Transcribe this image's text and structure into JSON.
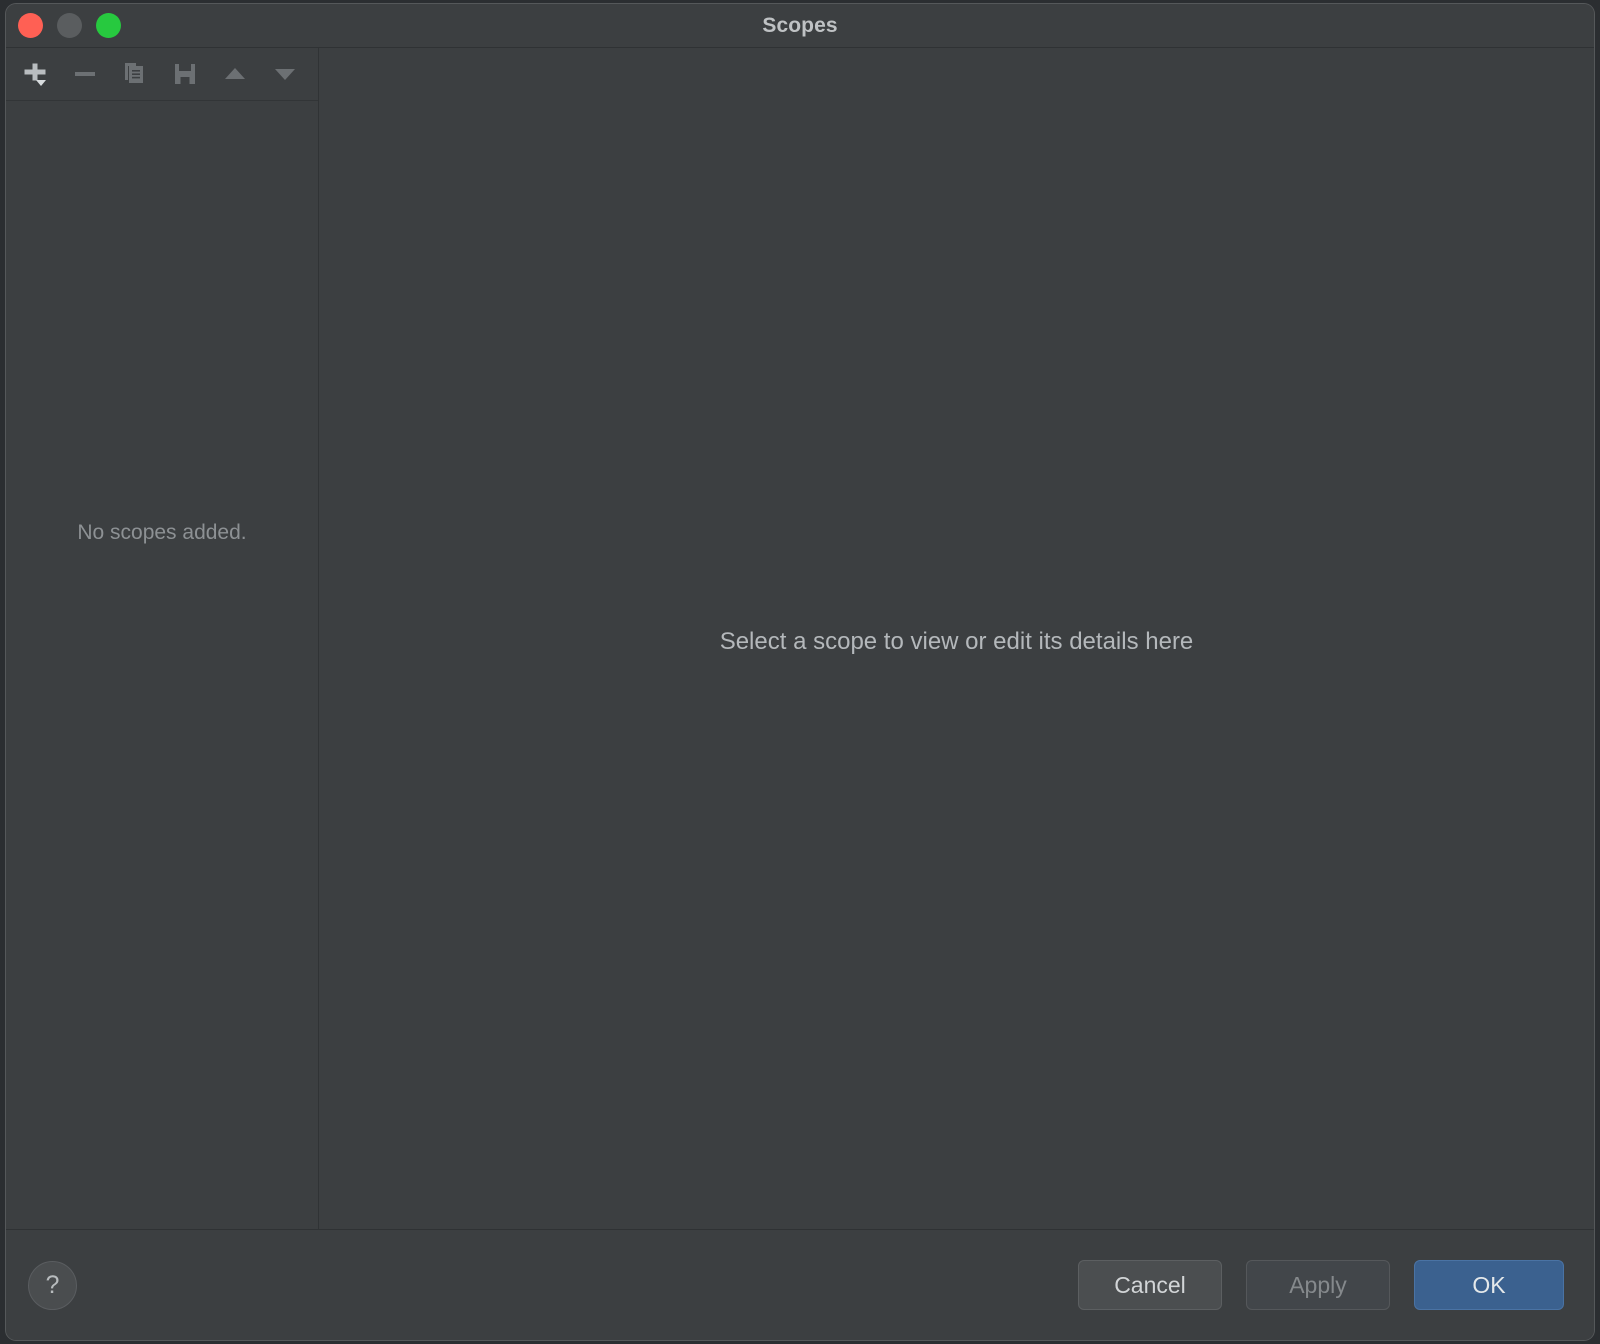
{
  "window": {
    "title": "Scopes",
    "traffic_lights": [
      {
        "name": "close",
        "color": "#ff6054"
      },
      {
        "name": "minimize",
        "color": "#5a5d5f"
      },
      {
        "name": "maximize",
        "color": "#27c93f"
      }
    ]
  },
  "toolbar": {
    "buttons": [
      {
        "name": "add-scope-button",
        "icon": "plus-dropdown-icon",
        "enabled": true
      },
      {
        "name": "remove-scope-button",
        "icon": "minus-icon",
        "enabled": false
      },
      {
        "name": "copy-scope-button",
        "icon": "copy-icon",
        "enabled": false
      },
      {
        "name": "save-scope-button",
        "icon": "save-floppy-icon",
        "enabled": false
      },
      {
        "name": "move-up-button",
        "icon": "triangle-up-icon",
        "enabled": false
      },
      {
        "name": "move-down-button",
        "icon": "triangle-down-icon",
        "enabled": false
      }
    ]
  },
  "sidebar": {
    "empty_message": "No scopes added."
  },
  "detail": {
    "hint": "Select a scope to view or edit its details here"
  },
  "footer": {
    "help_label": "?",
    "cancel_label": "Cancel",
    "apply_label": "Apply",
    "ok_label": "OK",
    "apply_enabled": false
  },
  "colors": {
    "window_bg": "#3c3f41",
    "desktop_bg": "#2b2e31",
    "accent_ok": "#3b618f",
    "text_primary": "#bfc2c4",
    "text_muted": "#8d9194"
  }
}
